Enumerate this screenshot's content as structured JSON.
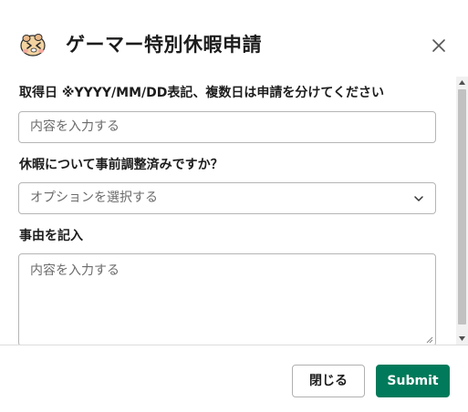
{
  "header": {
    "title": "ゲーマー特別休暇申請",
    "app_icon": "hamster-app-icon",
    "close_icon": "close-icon"
  },
  "form": {
    "date_field": {
      "label": "取得日 ※YYYY/MM/DD表記、複数日は申請を分けてください",
      "placeholder": "内容を入力する"
    },
    "prior_adjustment_field": {
      "label": "休暇について事前調整済みですか？",
      "placeholder": "オプションを選択する"
    },
    "reason_field": {
      "label": "事由を記入",
      "placeholder": "内容を入力する"
    }
  },
  "footer": {
    "close_label": "閉じる",
    "submit_label": "Submit"
  },
  "colors": {
    "submit_bg": "#007a5a",
    "text": "#1d1c1d",
    "border": "#b5b5b5"
  }
}
